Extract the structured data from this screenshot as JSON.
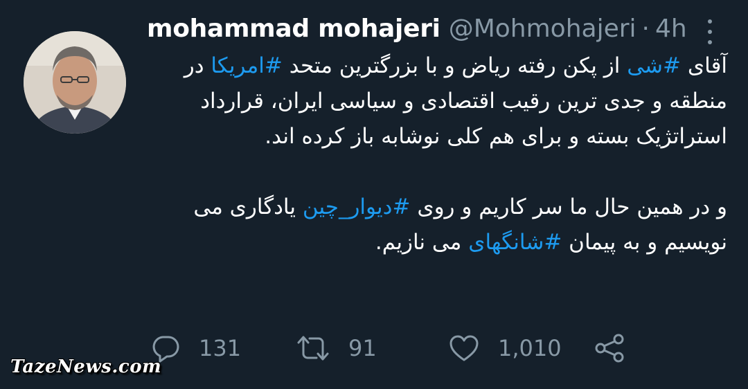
{
  "author": {
    "name": "mohammad mohajeri",
    "handle": "@Mohmohajeri",
    "separator": "·",
    "time": "4h"
  },
  "tweet": {
    "para1": {
      "t1": "آقای ",
      "h1": "#شی",
      "t2": " از پکن رفته ریاض و با بزرگترین متحد ",
      "h2": "#امریکا",
      "t3": " در منطقه و جدی ترین رقیب اقتصادی و سیاسی ایران، قرارداد استراتژیک بسته و برای هم کلی نوشابه باز کرده اند."
    },
    "para2": {
      "t1": "و در همین حال ما سر کاریم و روی ",
      "h1": "#دیوار_چین",
      "t2": " یادگاری می نویسیم و به پیمان ",
      "h2": "#شانگهای",
      "t3": " می نازیم."
    }
  },
  "actions": {
    "replies": "131",
    "retweets": "91",
    "likes": "1,010"
  },
  "icons": {
    "reply": "reply-icon",
    "retweet": "retweet-icon",
    "like": "heart-icon",
    "share": "share-icon",
    "more": "more-icon"
  },
  "watermark": "TazeNews.com",
  "colors": {
    "background": "#15202b",
    "text": "#ffffff",
    "secondary": "#8899a6",
    "hashtag": "#1d9bf0"
  }
}
